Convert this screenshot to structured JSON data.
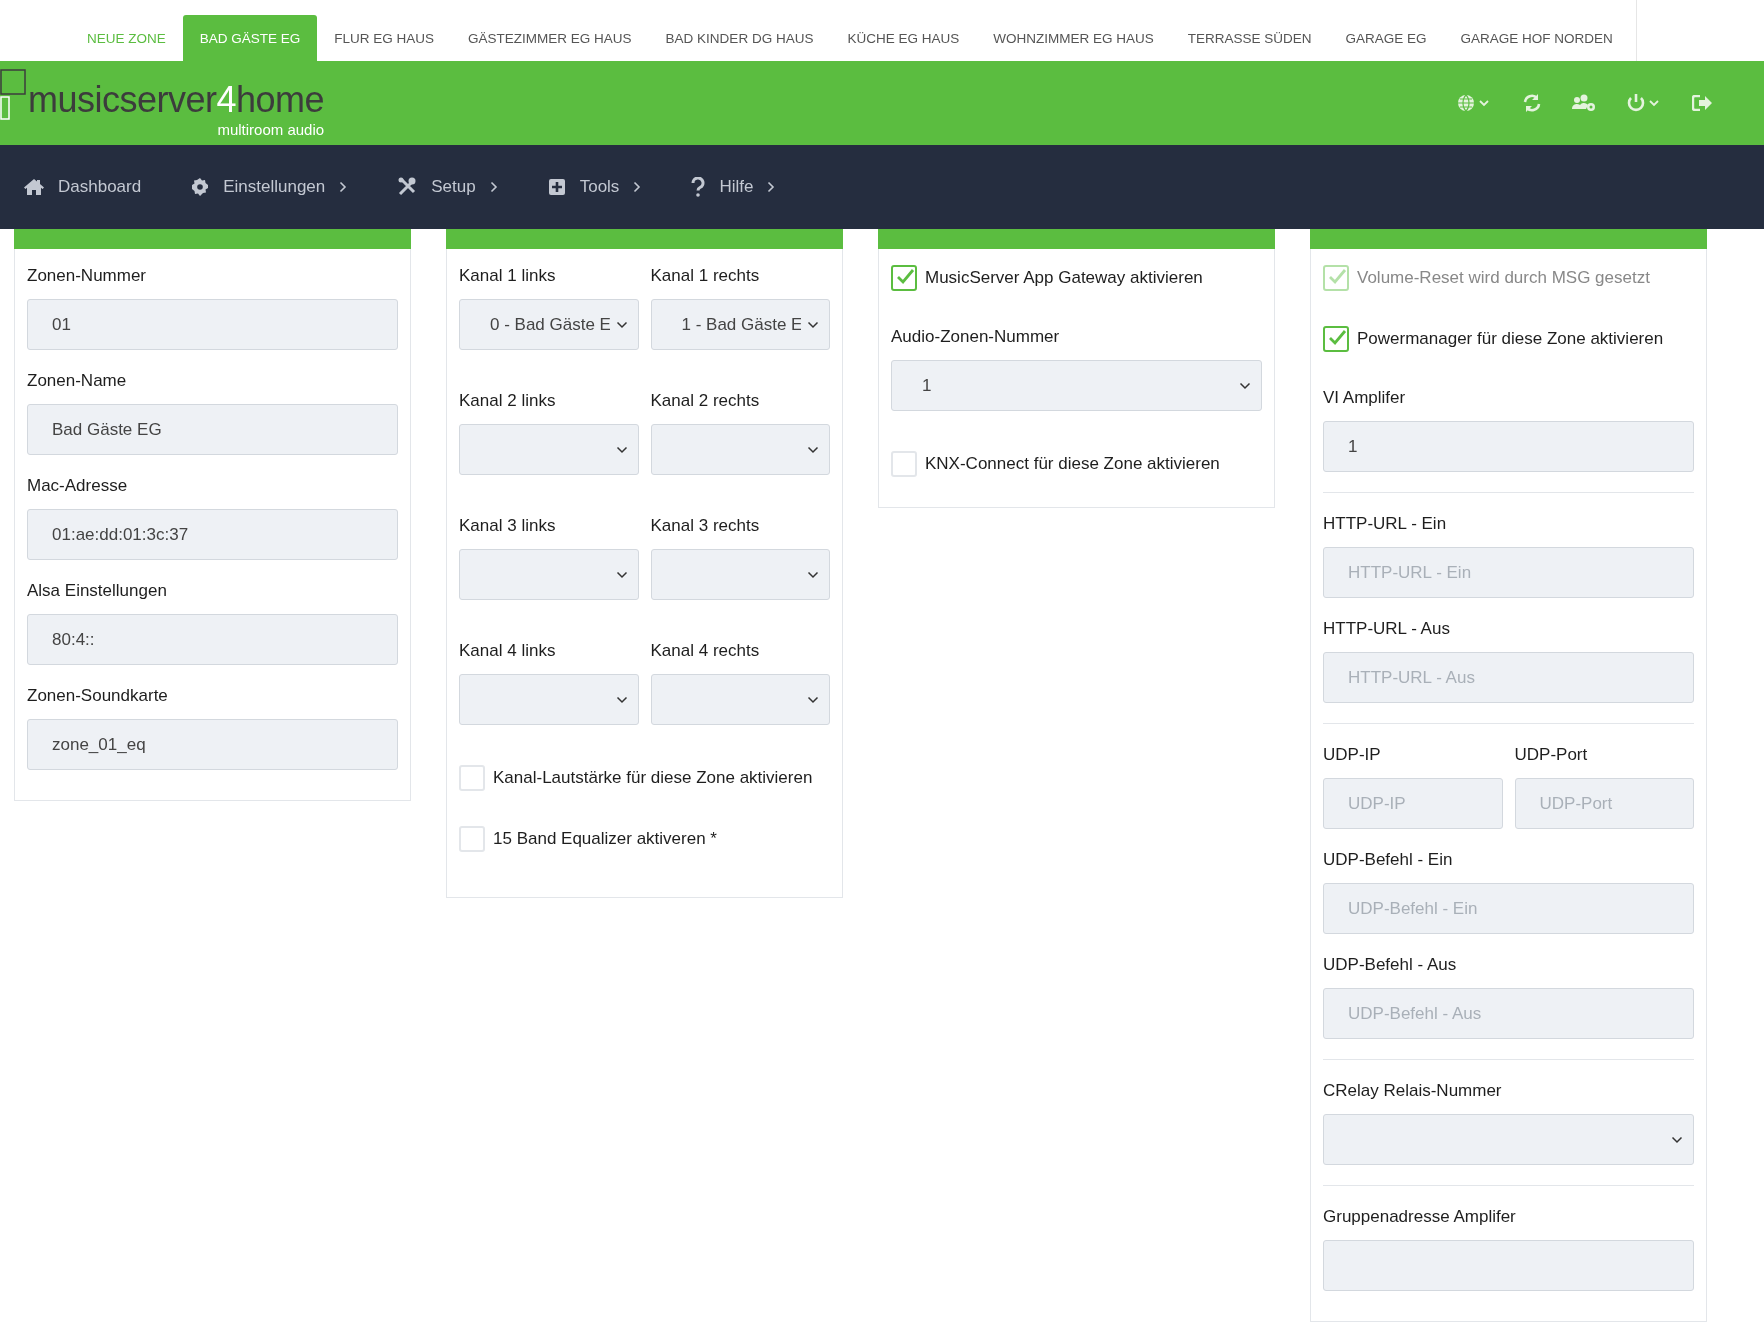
{
  "zone_tabs": [
    {
      "label": "NEUE ZONE",
      "kind": "new",
      "selected": false
    },
    {
      "label": "BAD GÄSTE EG",
      "kind": "zone",
      "selected": true
    },
    {
      "label": "FLUR EG HAUS",
      "kind": "zone",
      "selected": false
    },
    {
      "label": "GÄSTEZIMMER EG HAUS",
      "kind": "zone",
      "selected": false
    },
    {
      "label": "BAD KINDER DG HAUS",
      "kind": "zone",
      "selected": false
    },
    {
      "label": "KÜCHE EG HAUS",
      "kind": "zone",
      "selected": false
    },
    {
      "label": "WOHNZIMMER EG HAUS",
      "kind": "zone",
      "selected": false
    },
    {
      "label": "TERRASSE SÜDEN",
      "kind": "zone",
      "selected": false
    },
    {
      "label": "GARAGE EG",
      "kind": "zone",
      "selected": false
    },
    {
      "label": "GARAGE HOF NORDEN",
      "kind": "zone",
      "selected": false
    }
  ],
  "logo": {
    "part_1": "musicserver",
    "part_2": "4",
    "part_3": "home",
    "tagline": "multiroom audio"
  },
  "nav": [
    {
      "label": "Dashboard",
      "kind": "home",
      "submenu": false
    },
    {
      "label": "Einstellungen",
      "kind": "gear",
      "submenu": true
    },
    {
      "label": "Setup",
      "kind": "tools",
      "submenu": true
    },
    {
      "label": "Tools",
      "kind": "plus",
      "submenu": true
    },
    {
      "label": "Hilfe",
      "kind": "question",
      "submenu": true
    }
  ],
  "cards": [
    {
      "items": [
        {
          "kind": "input",
          "label": "Zonen-Nummer",
          "value": "01"
        },
        {
          "kind": "input",
          "label": "Zonen-Name",
          "value": "Bad Gäste EG"
        },
        {
          "kind": "input",
          "label": "Mac-Adresse",
          "value": "01:ae:dd:01:3c:37"
        },
        {
          "kind": "input",
          "label": "Alsa Einstellungen",
          "value": "80:4::"
        },
        {
          "kind": "input",
          "label": "Zonen-Soundkarte",
          "value": "zone_01_eq"
        }
      ]
    },
    {
      "items": [
        {
          "kind": "pair",
          "fields": [
            {
              "kind": "select",
              "label": "Kanal 1 links",
              "value": "0 - Bad Gäste E"
            },
            {
              "kind": "select",
              "label": "Kanal 1 rechts",
              "value": "1 - Bad Gäste E"
            }
          ]
        },
        {
          "kind": "pair",
          "fields": [
            {
              "kind": "select",
              "label": "Kanal 2 links"
            },
            {
              "kind": "select",
              "label": "Kanal 2 rechts"
            }
          ]
        },
        {
          "kind": "pair",
          "fields": [
            {
              "kind": "select",
              "label": "Kanal 3 links"
            },
            {
              "kind": "select",
              "label": "Kanal 3 rechts"
            }
          ]
        },
        {
          "kind": "pair",
          "fields": [
            {
              "kind": "select",
              "label": "Kanal 4 links"
            },
            {
              "kind": "select",
              "label": "Kanal 4 rechts"
            }
          ]
        },
        {
          "kind": "checkbox",
          "label": "Kanal-Lautstärke für diese Zone aktivieren",
          "checked": false,
          "disabled": false
        },
        {
          "kind": "checkbox",
          "label": "15 Band Equalizer aktiveren *",
          "checked": false,
          "disabled": false
        }
      ]
    },
    {
      "items": [
        {
          "kind": "checkbox",
          "label": "MusicServer App Gateway aktivieren",
          "checked": true,
          "disabled": false
        },
        {
          "kind": "select",
          "label": "Audio-Zonen-Nummer",
          "value": "1"
        },
        {
          "kind": "checkbox",
          "label": "KNX-Connect für diese Zone aktivieren",
          "checked": false,
          "disabled": false
        }
      ]
    },
    {
      "items": [
        {
          "kind": "checkbox",
          "label": "Volume-Reset wird durch MSG gesetzt",
          "checked": true,
          "disabled": true
        },
        {
          "kind": "checkbox",
          "label": "Powermanager für diese Zone aktivieren",
          "checked": true,
          "disabled": false
        },
        {
          "kind": "input",
          "label": "VI Amplifer",
          "value": "1"
        },
        {
          "kind": "divider"
        },
        {
          "kind": "input",
          "label": "HTTP-URL - Ein",
          "placeholder": "HTTP-URL - Ein"
        },
        {
          "kind": "input",
          "label": "HTTP-URL - Aus",
          "placeholder": "HTTP-URL - Aus"
        },
        {
          "kind": "divider"
        },
        {
          "kind": "pair",
          "fields": [
            {
              "kind": "input",
              "label": "UDP-IP",
              "placeholder": "UDP-IP"
            },
            {
              "kind": "input",
              "label": "UDP-Port",
              "placeholder": "UDP-Port"
            }
          ]
        },
        {
          "kind": "input",
          "label": "UDP-Befehl - Ein",
          "placeholder": "UDP-Befehl - Ein"
        },
        {
          "kind": "input",
          "label": "UDP-Befehl - Aus",
          "placeholder": "UDP-Befehl - Aus"
        },
        {
          "kind": "divider"
        },
        {
          "kind": "select",
          "label": "CRelay Relais-Nummer"
        },
        {
          "kind": "divider"
        },
        {
          "kind": "input",
          "label": "Gruppenadresse Amplifer"
        }
      ]
    }
  ]
}
